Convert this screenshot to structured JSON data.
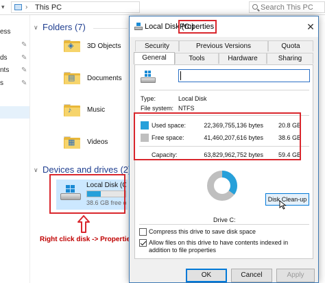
{
  "explorer": {
    "path": "This PC",
    "search_placeholder": "Search This PC",
    "nav_items": [
      "ess",
      "ds",
      "nts",
      "s",
      ""
    ],
    "folders_header": "Folders (7)",
    "folders": [
      {
        "label": "3D Objects",
        "icon": "3d-objects-folder-icon"
      },
      {
        "label": "Documents",
        "icon": "documents-folder-icon"
      },
      {
        "label": "Music",
        "icon": "music-folder-icon"
      },
      {
        "label": "Videos",
        "icon": "videos-folder-icon"
      }
    ],
    "devices_header": "Devices and drives (2)",
    "drive": {
      "name": "Local Disk (C:)",
      "free_text": "38.6 GB free of 59.4 GB",
      "used_fraction": 0.35
    }
  },
  "annotation": {
    "text": "Right click disk -> Properties",
    "color": "#c00000"
  },
  "dialog": {
    "title_drive": "Local Disk (C:)",
    "title_suffix": "Properties",
    "close_glyph": "✕",
    "tabs_top": [
      "Security",
      "Previous Versions",
      "Quota"
    ],
    "tabs_bottom": [
      "General",
      "Tools",
      "Hardware",
      "Sharing"
    ],
    "active_tab": "General",
    "name_value": "",
    "type_label": "Type:",
    "type_value": "Local Disk",
    "fs_label": "File system:",
    "fs_value": "NTFS",
    "used_label": "Used space:",
    "used_bytes": "22,369,755,136 bytes",
    "used_gb": "20.8 GB",
    "free_label": "Free space:",
    "free_bytes": "41,460,207,616 bytes",
    "free_gb": "38.6 GB",
    "capacity_label": "Capacity:",
    "capacity_bytes": "63,829,962,752 bytes",
    "capacity_gb": "59.4 GB",
    "used_color": "#26a0da",
    "free_color": "#bfbfbf",
    "drive_label": "Drive C:",
    "cleanup_label": "Disk Clean-up",
    "compress_label": "Compress this drive to save disk space",
    "compress_checked": false,
    "index_label": "Allow files on this drive to have contents indexed in addition to file properties",
    "index_checked": true,
    "ok_label": "OK",
    "cancel_label": "Cancel",
    "apply_label": "Apply"
  },
  "highlight_color": "#d9262c"
}
